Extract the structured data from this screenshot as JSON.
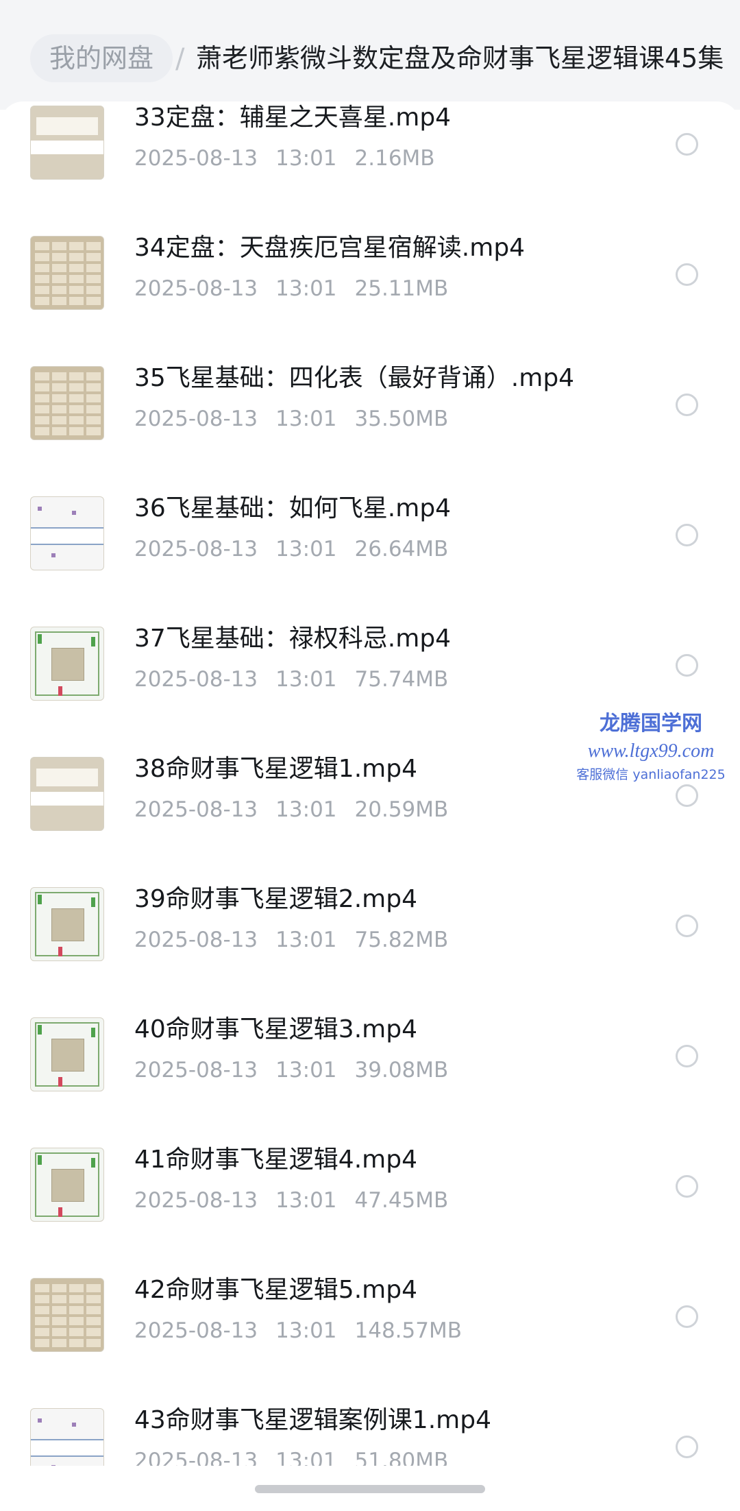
{
  "breadcrumb": {
    "home": "我的网盘",
    "separator": "/",
    "current": "萧老师紫微斗数定盘及命财事飞星逻辑课45集"
  },
  "files": [
    {
      "name": "33定盘：辅星之天喜星.mp4",
      "date": "2025-08-13",
      "time": "13:01",
      "size": "2.16MB",
      "thumb": "card"
    },
    {
      "name": "34定盘：天盘疾厄宫星宿解读.mp4",
      "date": "2025-08-13",
      "time": "13:01",
      "size": "25.11MB",
      "thumb": "table"
    },
    {
      "name": "35飞星基础：四化表（最好背诵）.mp4",
      "date": "2025-08-13",
      "time": "13:01",
      "size": "35.50MB",
      "thumb": "table"
    },
    {
      "name": "36飞星基础：如何飞星.mp4",
      "date": "2025-08-13",
      "time": "13:01",
      "size": "26.64MB",
      "thumb": "chart"
    },
    {
      "name": "37飞星基础：禄权科忌.mp4",
      "date": "2025-08-13",
      "time": "13:01",
      "size": "75.74MB",
      "thumb": "grid"
    },
    {
      "name": "38命财事飞星逻辑1.mp4",
      "date": "2025-08-13",
      "time": "13:01",
      "size": "20.59MB",
      "thumb": "card"
    },
    {
      "name": "39命财事飞星逻辑2.mp4",
      "date": "2025-08-13",
      "time": "13:01",
      "size": "75.82MB",
      "thumb": "grid"
    },
    {
      "name": "40命财事飞星逻辑3.mp4",
      "date": "2025-08-13",
      "time": "13:01",
      "size": "39.08MB",
      "thumb": "grid"
    },
    {
      "name": "41命财事飞星逻辑4.mp4",
      "date": "2025-08-13",
      "time": "13:01",
      "size": "47.45MB",
      "thumb": "grid"
    },
    {
      "name": "42命财事飞星逻辑5.mp4",
      "date": "2025-08-13",
      "time": "13:01",
      "size": "148.57MB",
      "thumb": "table"
    },
    {
      "name": "43命财事飞星逻辑案例课1.mp4",
      "date": "2025-08-13",
      "time": "13:01",
      "size": "51.80MB",
      "thumb": "chart"
    }
  ],
  "watermark": {
    "title": "龙腾国学网",
    "url": "www.ltgx99.com",
    "contact": "客服微信 yanliaofan225"
  },
  "colors": {
    "accent_watermark": "#4d6fd6",
    "meta_text": "#a4a9b0",
    "title_text": "#16191d"
  }
}
